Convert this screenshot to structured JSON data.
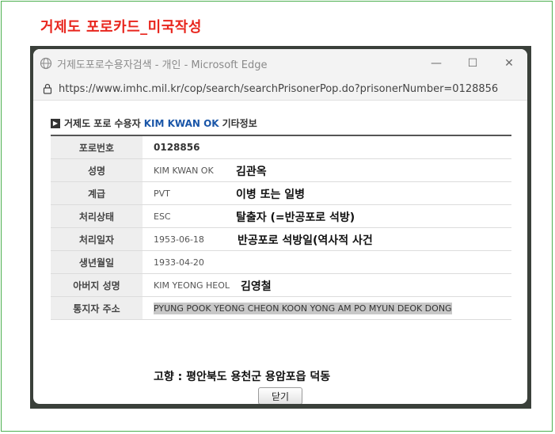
{
  "page": {
    "title": "거제도 포로카드_미국작성"
  },
  "window": {
    "title": "거제도포로수용자검색 - 개인 - Microsoft Edge",
    "controls": {
      "minimize": "—",
      "maximize": "☐",
      "close": "✕"
    }
  },
  "addressbar": {
    "url": "https://www.imhc.mil.kr/cop/search/searchPrisonerPop.do?prisonerNumber=0128856"
  },
  "section": {
    "prefix": "거제도 포로 수용자",
    "name": "KIM KWAN OK",
    "suffix": "기타정보"
  },
  "rows": [
    {
      "label": "포로번호",
      "value": "0128856",
      "annotation": ""
    },
    {
      "label": "성명",
      "value": "KIM KWAN OK",
      "annotation": "김관옥"
    },
    {
      "label": "계급",
      "value": "PVT",
      "annotation": "이병 또는 일병"
    },
    {
      "label": "처리상태",
      "value": "ESC",
      "annotation": "탈출자 (=반공포로 석방)"
    },
    {
      "label": "처리일자",
      "value": "1953-06-18",
      "annotation": "반공포로 석방일(역사적 사건"
    },
    {
      "label": "생년월일",
      "value": "1933-04-20",
      "annotation": ""
    },
    {
      "label": "아버지 성명",
      "value": "KIM YEONG HEOL",
      "annotation": "김영철"
    },
    {
      "label": "통지자 주소",
      "value": "PYUNG POOK YEONG CHEON KOON YONG AM PO MYUN DEOK DONG",
      "annotation": ""
    }
  ],
  "hometown_note": "고향 : 평안북도 용천군 용암포읍 덕동",
  "close_button": "닫기"
}
